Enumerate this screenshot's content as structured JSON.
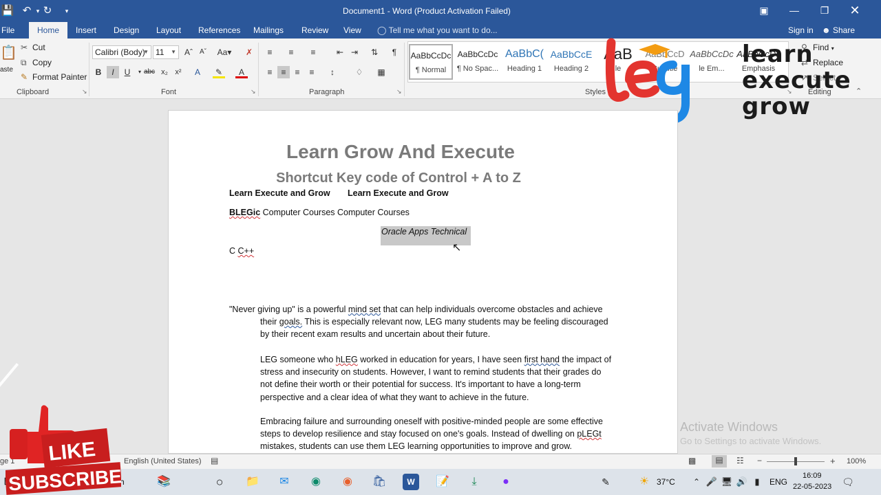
{
  "titlebar": {
    "title": "Document1 - Word (Product Activation Failed)"
  },
  "tabs": [
    {
      "label": "File"
    },
    {
      "label": "Home"
    },
    {
      "label": "Insert"
    },
    {
      "label": "Design"
    },
    {
      "label": "Layout"
    },
    {
      "label": "References"
    },
    {
      "label": "Mailings"
    },
    {
      "label": "Review"
    },
    {
      "label": "View"
    }
  ],
  "tellme": "Tell me what you want to do...",
  "signin": "Sign in",
  "share": "Share",
  "clipboard": {
    "paste": "aste",
    "cut": "Cut",
    "copy": "Copy",
    "format_painter": "Format Painter",
    "label": "Clipboard"
  },
  "font": {
    "family": "Calibri (Body)",
    "size": "11",
    "label": "Font"
  },
  "paragraph": {
    "label": "Paragraph"
  },
  "styles": {
    "label": "Styles",
    "items": [
      {
        "preview": "AaBbCcDc",
        "name": "¶ Normal"
      },
      {
        "preview": "AaBbCcDc",
        "name": "¶ No Spac..."
      },
      {
        "preview": "AaBbC(",
        "name": "Heading 1"
      },
      {
        "preview": "AaBbCcE",
        "name": "Heading 2"
      },
      {
        "preview": "AaB",
        "name": "le"
      },
      {
        "preview": "AaBbCcD",
        "name": "Subtitle"
      },
      {
        "preview": "AaBbCcDc",
        "name": "le Em..."
      },
      {
        "preview": "AaBbCcDc",
        "name": "Emphasis"
      }
    ]
  },
  "editing": {
    "find": "Find",
    "replace": "Replace",
    "select": "Select",
    "label": "Editing"
  },
  "logo": {
    "letters": "leg",
    "text_line1": "learn",
    "text_line2": "execute",
    "text_line3": "grow"
  },
  "document": {
    "title": "Learn Grow And Execute",
    "subtitle": "Shortcut Key code of Control + A to Z",
    "line1a": "Learn Execute and Grow",
    "line1b": "Learn Execute and Grow",
    "line2_bold": "BLEGic",
    "line2_rest": " Computer Courses   Computer Courses",
    "oracle": "Oracle Apps Technical",
    "cpp_c": "C ",
    "cpp_cpp": "C++",
    "p1_a": "\"Never giving up\" is a powerful ",
    "p1_mindset": "mind set",
    "p1_b": " that can help individuals overcome obstacles and achieve",
    "p1_c": "their ",
    "p1_goals": "goals.",
    "p1_d": " This is especially relevant now, LEG many students may be feeling discouraged",
    "p1_e": "by their recent exam results and uncertain about their future.",
    "p2_a": "LEG someone who ",
    "p2_hleg": "hLEG",
    "p2_b": " worked in education for years, I have seen ",
    "p2_firsthand": "first hand",
    "p2_c": " the impact of",
    "p2_d": "stress and insecurity on students. However, I want to remind students that their grades do",
    "p2_e": "not define their worth or their potential for success. It's important to have a long-term",
    "p2_f": "perspective and a clear idea of what they want to achieve in the future.",
    "p3_a": "Embracing failure and surrounding oneself with positive-minded people are some effective",
    "p3_b": "steps to develop resilience and stay focused on one's goals. Instead of dwelling on ",
    "p3_plegt": "pLEGt",
    "p3_c": "mistakes, students can use them LEG learning opportunities to improve and grow."
  },
  "watermark": {
    "line1": "Activate Windows",
    "line2": "Go to Settings to activate Windows."
  },
  "statusbar": {
    "page": "ge 1",
    "language": "English (United States)",
    "zoom": "100%"
  },
  "overlay": {
    "like": "LIKE",
    "subscribe": "SUBSCRIBE"
  },
  "taskbar": {
    "search_fragment": "ch",
    "weather": "37°C",
    "lang": "ENG",
    "time": "16:09",
    "date": "22-05-2023"
  }
}
